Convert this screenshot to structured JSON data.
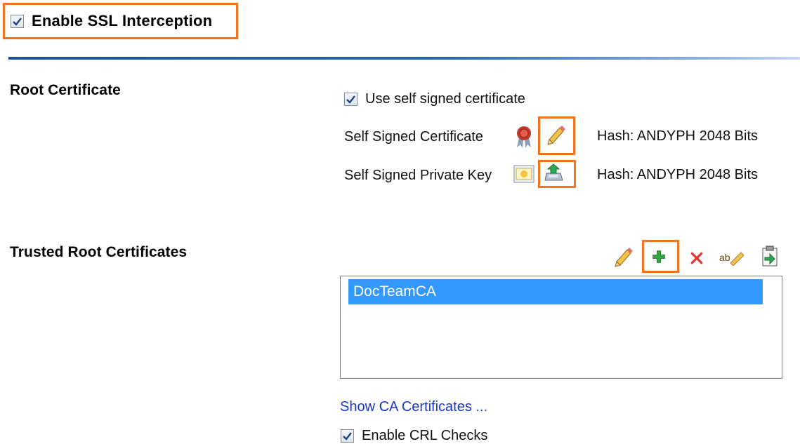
{
  "ssl": {
    "enable_label": "Enable SSL Interception",
    "enabled": true
  },
  "root_certificate": {
    "title": "Root Certificate",
    "use_self_signed_label": "Use self signed certificate",
    "use_self_signed_checked": true,
    "self_signed_cert_label": "Self Signed Certificate",
    "self_signed_cert_hash": "Hash: ANDYPH 2048 Bits",
    "self_signed_key_label": "Self Signed Private Key",
    "self_signed_key_hash": "Hash: ANDYPH 2048 Bits",
    "icons": [
      "certificate-icon",
      "pencil-edit-icon",
      "private-key-icon",
      "export-icon"
    ]
  },
  "trusted_root": {
    "title": "Trusted Root Certificates",
    "toolbar_icons": [
      "pencil-edit-icon",
      "add-icon",
      "delete-icon",
      "rename-icon",
      "import-icon"
    ],
    "items": [
      {
        "label": "DocTeamCA",
        "selected": true
      }
    ],
    "show_ca_link": "Show CA Certificates ...",
    "enable_crl_label": "Enable CRL Checks",
    "enable_crl_checked": true
  },
  "colors": {
    "highlight_box": "#f0731f",
    "selection": "#3399ff",
    "link": "#1a35c9",
    "rule": "#1a4f9c"
  }
}
